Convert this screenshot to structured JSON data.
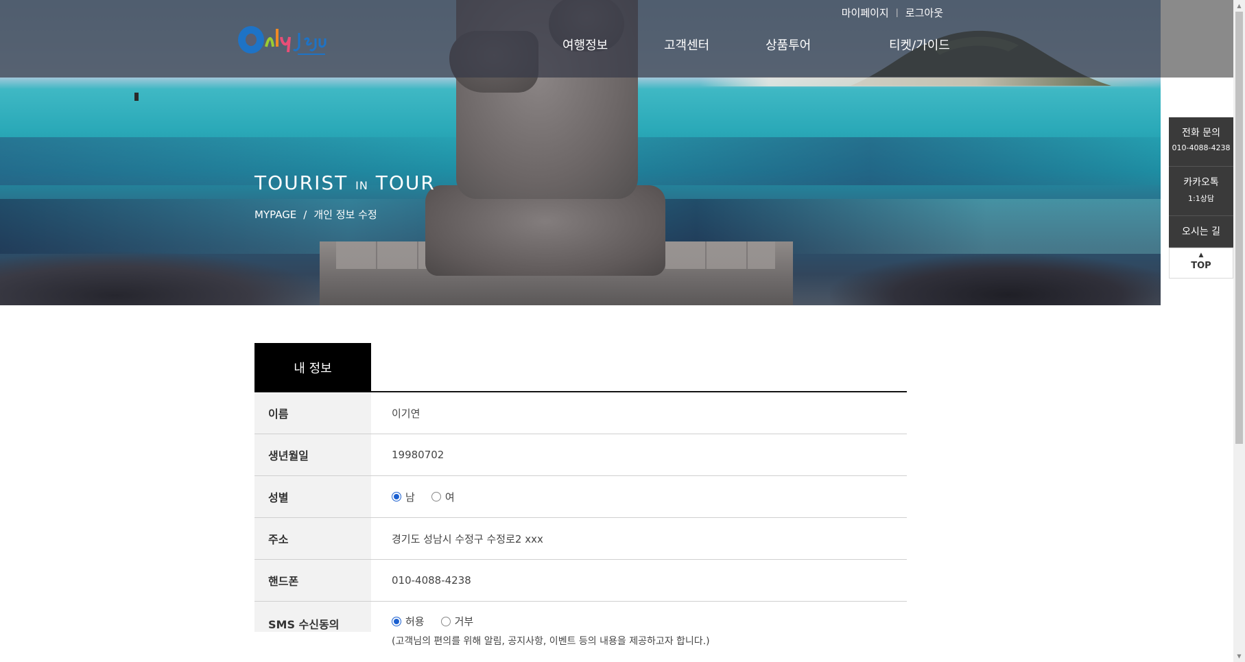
{
  "header": {
    "util_nav": {
      "mypage": "마이페이지",
      "separator": "|",
      "logout": "로그아웃"
    },
    "gnb": [
      "여행정보",
      "고객센터",
      "상품투어",
      "티켓/가이드"
    ],
    "logo_text": "Only Jeju"
  },
  "hero": {
    "title_main_1": "TOURIST",
    "title_small": "IN",
    "title_main_2": "TOUR",
    "breadcrumb": {
      "root": "MYPAGE",
      "separator": "/",
      "current": "개인 정보 수정"
    }
  },
  "quick_menu": {
    "phone_label": "전화 문의",
    "phone_number": "010-4088-4238",
    "kakao_label": "카카오톡",
    "kakao_sub": "1:1상담",
    "directions": "오시는 길",
    "top_arrow": "▲",
    "top_label": "TOP"
  },
  "tabs": {
    "active": "내 정보"
  },
  "info": {
    "name_label": "이름",
    "name_value": "이기연",
    "birth_label": "생년월일",
    "birth_value": "19980702",
    "gender_label": "성별",
    "gender_male": "남",
    "gender_female": "여",
    "gender_selected": "male",
    "address_label": "주소",
    "address_value": "경기도 성남시 수정구 수정로2 xxx",
    "phone_label": "핸드폰",
    "phone_value": "010-4088-4238",
    "sms_label": "SMS 수신동의",
    "sms_allow": "허용",
    "sms_deny": "거부",
    "sms_selected": "allow",
    "sms_note": "(고객님의 편의를 위해 알림, 공지사항, 이벤트 등의 내용을 제공하고자 합니다.)"
  },
  "colors": {
    "header_overlay": "#373a48",
    "tab_active_bg": "#000000",
    "table_header_bg": "#f2f2f2",
    "radio_accent": "#1a5fd0",
    "quick_menu_bg": "#3a3a3a"
  }
}
